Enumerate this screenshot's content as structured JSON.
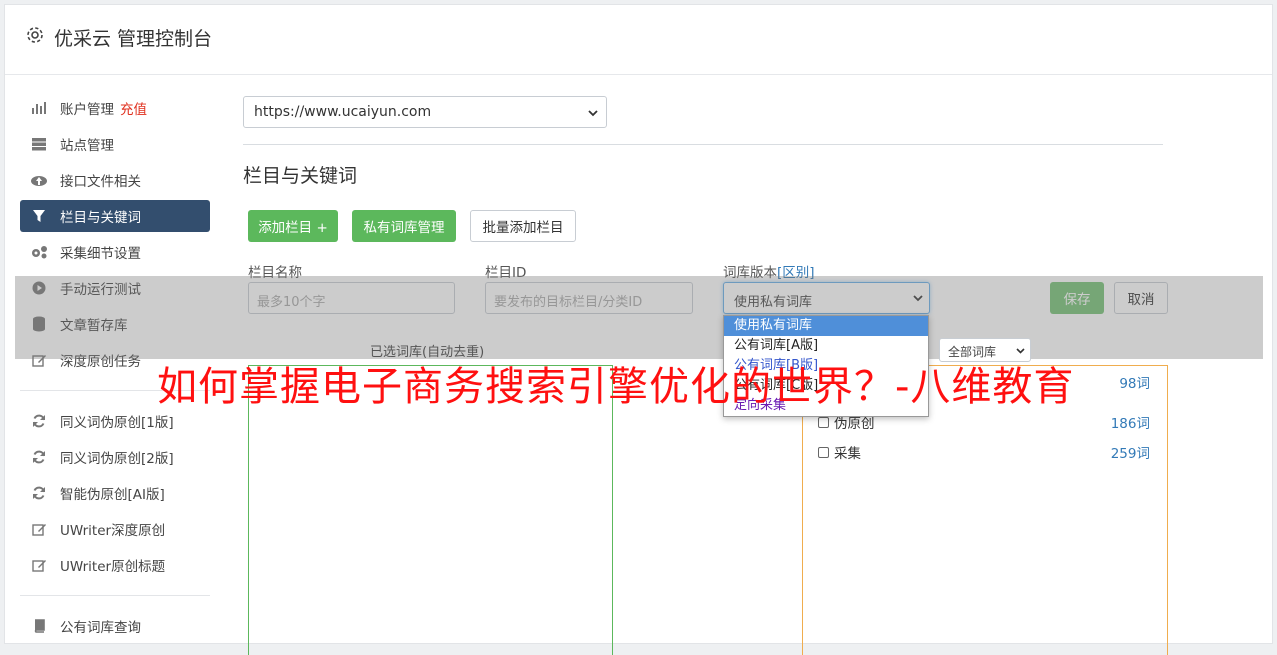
{
  "header": {
    "title": "优采云 管理控制台"
  },
  "sidebar": {
    "items": [
      {
        "label": "账户管理",
        "tag": "充值",
        "icon": "bar-chart-icon"
      },
      {
        "label": "站点管理",
        "icon": "server-icon"
      },
      {
        "label": "接口文件相关",
        "icon": "cloud-upload-icon"
      },
      {
        "label": "栏目与关键词",
        "icon": "filter-icon",
        "active": true
      },
      {
        "label": "采集细节设置",
        "icon": "cogs-icon"
      },
      {
        "label": "手动运行测试",
        "icon": "play-circle-icon"
      },
      {
        "label": "文章暂存库",
        "icon": "database-icon"
      },
      {
        "label": "深度原创任务",
        "icon": "edit-icon"
      }
    ],
    "items2": [
      {
        "label": "同义词伪原创[1版]",
        "icon": "refresh-icon"
      },
      {
        "label": "同义词伪原创[2版]",
        "icon": "refresh-icon"
      },
      {
        "label": "智能伪原创[AI版]",
        "icon": "refresh-icon"
      },
      {
        "label": "UWriter深度原创",
        "icon": "edit-icon"
      },
      {
        "label": "UWriter原创标题",
        "icon": "edit-icon"
      }
    ],
    "items3": [
      {
        "label": "公有词库查询",
        "icon": "book-icon"
      }
    ]
  },
  "main": {
    "site_select": "https://www.ucaiyun.com",
    "section_title": "栏目与关键词",
    "buttons": {
      "add": "添加栏目 +",
      "private_lib": "私有词库管理",
      "batch_add": "批量添加栏目"
    },
    "form": {
      "name_label": "栏目名称",
      "name_placeholder": "最多10个字",
      "id_label": "栏目ID",
      "id_placeholder": "要发布的目标栏目/分类ID",
      "lib_label": "词库版本",
      "lib_link": "[区别]",
      "lib_value": "使用私有词库",
      "save": "保存",
      "cancel": "取消"
    },
    "dropdown_options": [
      "使用私有词库",
      "公有词库[A版]",
      "公有词库[B版]",
      "公有词库[C版]",
      "定向采集"
    ],
    "selected_caption": "已选词库(自动去重)",
    "all_lib_select": "全部词库",
    "lib_rows": [
      {
        "label": "",
        "count": "98词"
      },
      {
        "label": "伪原创",
        "count": "186词"
      },
      {
        "label": "采集",
        "count": "259词"
      }
    ]
  },
  "watermark": "如何掌握电子商务搜索引擎优化的世界？-八维教育",
  "colors": {
    "active_nav": "#334e6e",
    "green": "#5cb85c",
    "orange": "#f0ad4e",
    "link": "#337ab7",
    "watermark": "#ff1010"
  }
}
